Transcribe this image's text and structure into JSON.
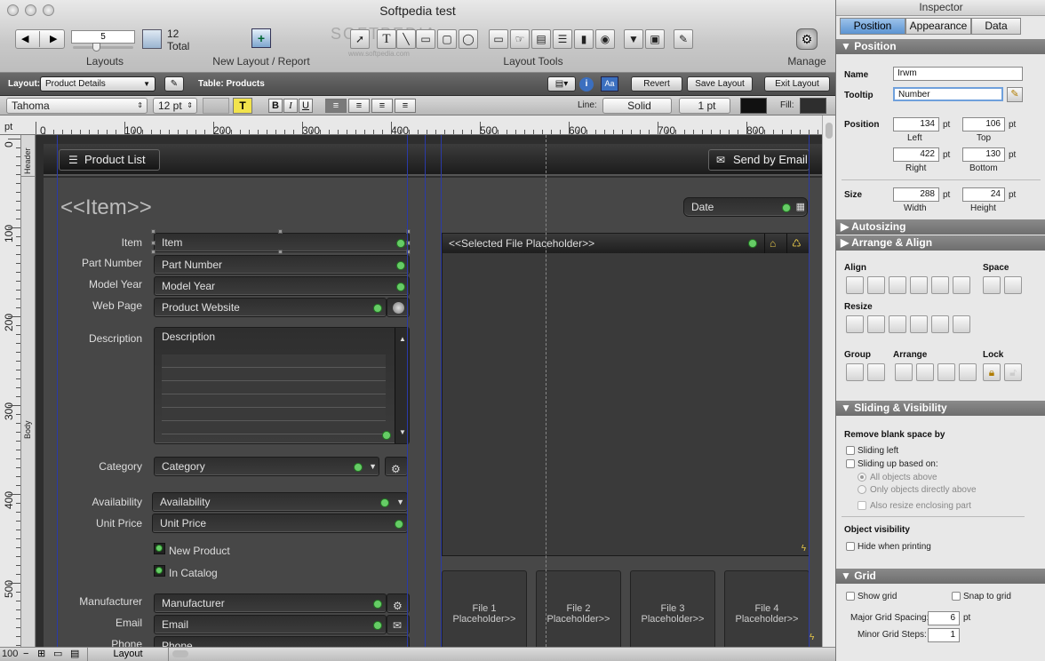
{
  "window": {
    "title": "Softpedia test",
    "watermark": "SOFTPEDIA",
    "watermark_url": "www.softpedia.com"
  },
  "toolbar": {
    "layouts_label": "Layouts",
    "layouts_value": "5",
    "count_value": "12",
    "count_label": "Total",
    "new_layout_label": "New Layout / Report",
    "layout_tools_label": "Layout Tools",
    "manage_label": "Manage"
  },
  "layoutbar": {
    "layout_label": "Layout:",
    "layout_value": "Product Details",
    "table_label": "Table: Products",
    "revert": "Revert",
    "save": "Save Layout",
    "exit": "Exit Layout"
  },
  "formatbar": {
    "font": "Tahoma",
    "size": "12 pt",
    "bold": "B",
    "italic": "I",
    "underline": "U",
    "line_label": "Line:",
    "line_style": "Solid",
    "line_width": "1 pt",
    "fill_label": "Fill:"
  },
  "ruler": {
    "unit": "pt",
    "h_marks": [
      "0",
      "100",
      "200",
      "300",
      "400",
      "500",
      "600",
      "700",
      "800"
    ],
    "v_marks": [
      "0",
      "100",
      "200",
      "300",
      "400",
      "500"
    ]
  },
  "parts": {
    "header": "Header",
    "body": "Body"
  },
  "layout": {
    "product_list_btn": "Product List",
    "send_email_btn": "Send by Email",
    "item_title": "<<Item>>",
    "date_field": "Date",
    "fields": [
      {
        "label": "Item",
        "value": "Item"
      },
      {
        "label": "Part Number",
        "value": "Part Number"
      },
      {
        "label": "Model Year",
        "value": "Model Year"
      },
      {
        "label": "Web Page",
        "value": "Product Website"
      }
    ],
    "description_label": "Description",
    "description_value": "Description",
    "category_label": "Category",
    "category_value": "Category",
    "availability_label": "Availability",
    "availability_value": "Availability",
    "unit_price_label": "Unit Price",
    "unit_price_value": "Unit Price",
    "new_product": "New Product",
    "in_catalog": "In Catalog",
    "manufacturer_label": "Manufacturer",
    "manufacturer_value": "Manufacturer",
    "email_label": "Email",
    "email_value": "Email",
    "phone_label": "Phone",
    "phone_value": "Phone",
    "file_placeholder": "<<Selected File Placeholder>>",
    "thumbs": [
      {
        "title": "File 1",
        "sub": "Placeholder>>"
      },
      {
        "title": "File 2",
        "sub": "Placeholder>>"
      },
      {
        "title": "File 3",
        "sub": "Placeholder>>"
      },
      {
        "title": "File 4",
        "sub": "Placeholder>>"
      }
    ]
  },
  "status": {
    "zoom": "100",
    "mode": "Layout"
  },
  "inspector": {
    "title": "Inspector",
    "tabs": [
      "Position",
      "Appearance",
      "Data"
    ],
    "position_section": "Position",
    "name_label": "Name",
    "name_value": "Irwm",
    "tooltip_label": "Tooltip",
    "tooltip_value": "Number",
    "position_label": "Position",
    "left": "134",
    "top": "106",
    "right": "422",
    "bottom": "130",
    "unit": "pt",
    "left_label": "Left",
    "top_label": "Top",
    "right_label": "Right",
    "bottom_label": "Bottom",
    "size_label": "Size",
    "width": "288",
    "height": "24",
    "width_label": "Width",
    "height_label": "Height",
    "autosizing": "Autosizing",
    "arrange_align": "Arrange & Align",
    "align_label": "Align",
    "space_label": "Space",
    "resize_label": "Resize",
    "group_label": "Group",
    "arrange_label": "Arrange",
    "lock_label": "Lock",
    "sliding_section": "Sliding & Visibility",
    "remove_blank": "Remove blank space by",
    "sliding_left": "Sliding left",
    "sliding_up": "Sliding up based on:",
    "all_objects": "All objects above",
    "only_objects": "Only objects directly above",
    "also_resize": "Also resize enclosing part",
    "object_visibility": "Object visibility",
    "hide_printing": "Hide when printing",
    "grid_section": "Grid",
    "show_grid": "Show grid",
    "snap_grid": "Snap to grid",
    "major_label": "Major Grid Spacing:",
    "major_value": "6",
    "minor_label": "Minor Grid Steps:",
    "minor_value": "1"
  }
}
